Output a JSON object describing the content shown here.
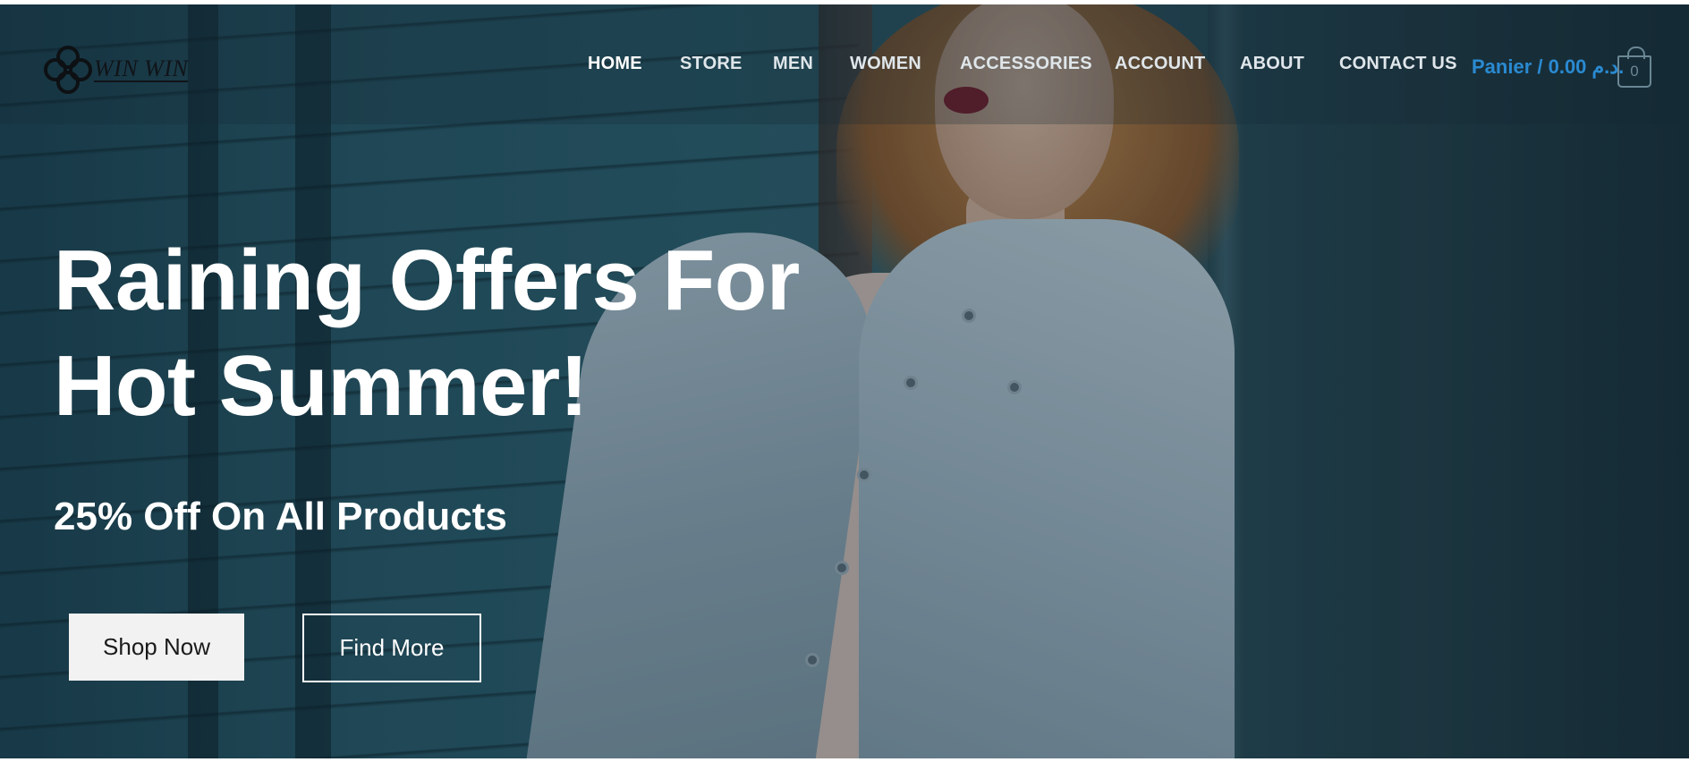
{
  "brand": {
    "name": "WIN WIN",
    "icon": "knot-logo-icon"
  },
  "nav": {
    "items": [
      {
        "label": "HOME",
        "active": true
      },
      {
        "label": "STORE",
        "active": false
      },
      {
        "label": "MEN",
        "active": false
      },
      {
        "label": "WOMEN",
        "active": false
      },
      {
        "label": "ACCESSORIES",
        "active": false
      },
      {
        "label": "ACCOUNT",
        "active": false
      },
      {
        "label": "ABOUT",
        "active": false
      },
      {
        "label": "CONTACT US",
        "active": false
      }
    ]
  },
  "cart": {
    "label": "Panier / 0.00 د.م.",
    "count": "0",
    "icon": "shopping-bag-icon",
    "color": "#2a8ad1"
  },
  "hero": {
    "headline_line1": "Raining Offers For",
    "headline_line2": "Hot Summer!",
    "subheadline": "25% Off On All Products",
    "primary_button": "Shop Now",
    "secondary_button": "Find More"
  }
}
